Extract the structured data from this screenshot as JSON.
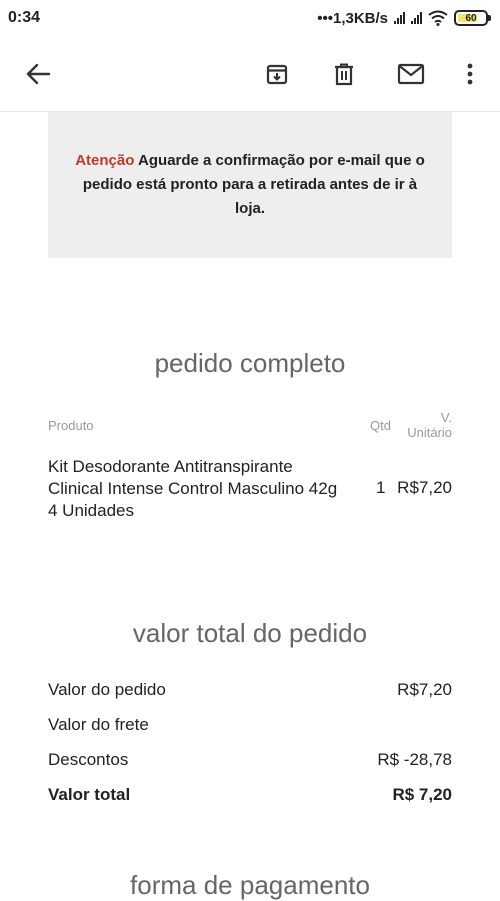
{
  "status_bar": {
    "time": "0:34",
    "network_speed": "•••1,3KB/s",
    "battery": "60"
  },
  "toolbar": {
    "icons": [
      "back-arrow-icon",
      "archive-icon",
      "trash-icon",
      "mail-icon",
      "more-vert-icon"
    ]
  },
  "notice": {
    "attention": "Atenção",
    "message": "Aguarde a confirmação por e-mail que o pedido está pronto para a retirada antes de ir à loja."
  },
  "order": {
    "title": "pedido completo",
    "headers": {
      "product": "Produto",
      "qty": "Qtd",
      "unit_price_line1": "V.",
      "unit_price_line2": "Unitário"
    },
    "items": [
      {
        "name": "Kit Desodorante Antitranspirante Clinical Intense Control Masculino 42g 4 Unidades",
        "qty": "1",
        "unit_price": "R$7,20"
      }
    ]
  },
  "totals": {
    "title": "valor total do pedido",
    "rows": [
      {
        "label": "Valor do pedido",
        "value": "R$7,20"
      },
      {
        "label": "Valor do frete",
        "value": ""
      },
      {
        "label": "Descontos",
        "value": "R$ -28,78"
      },
      {
        "label": "Valor total",
        "value": "R$ 7,20"
      }
    ]
  },
  "payment": {
    "title": "forma de pagamento"
  },
  "colors": {
    "attention": "#c0392b",
    "notice_bg": "#eeeeee"
  }
}
